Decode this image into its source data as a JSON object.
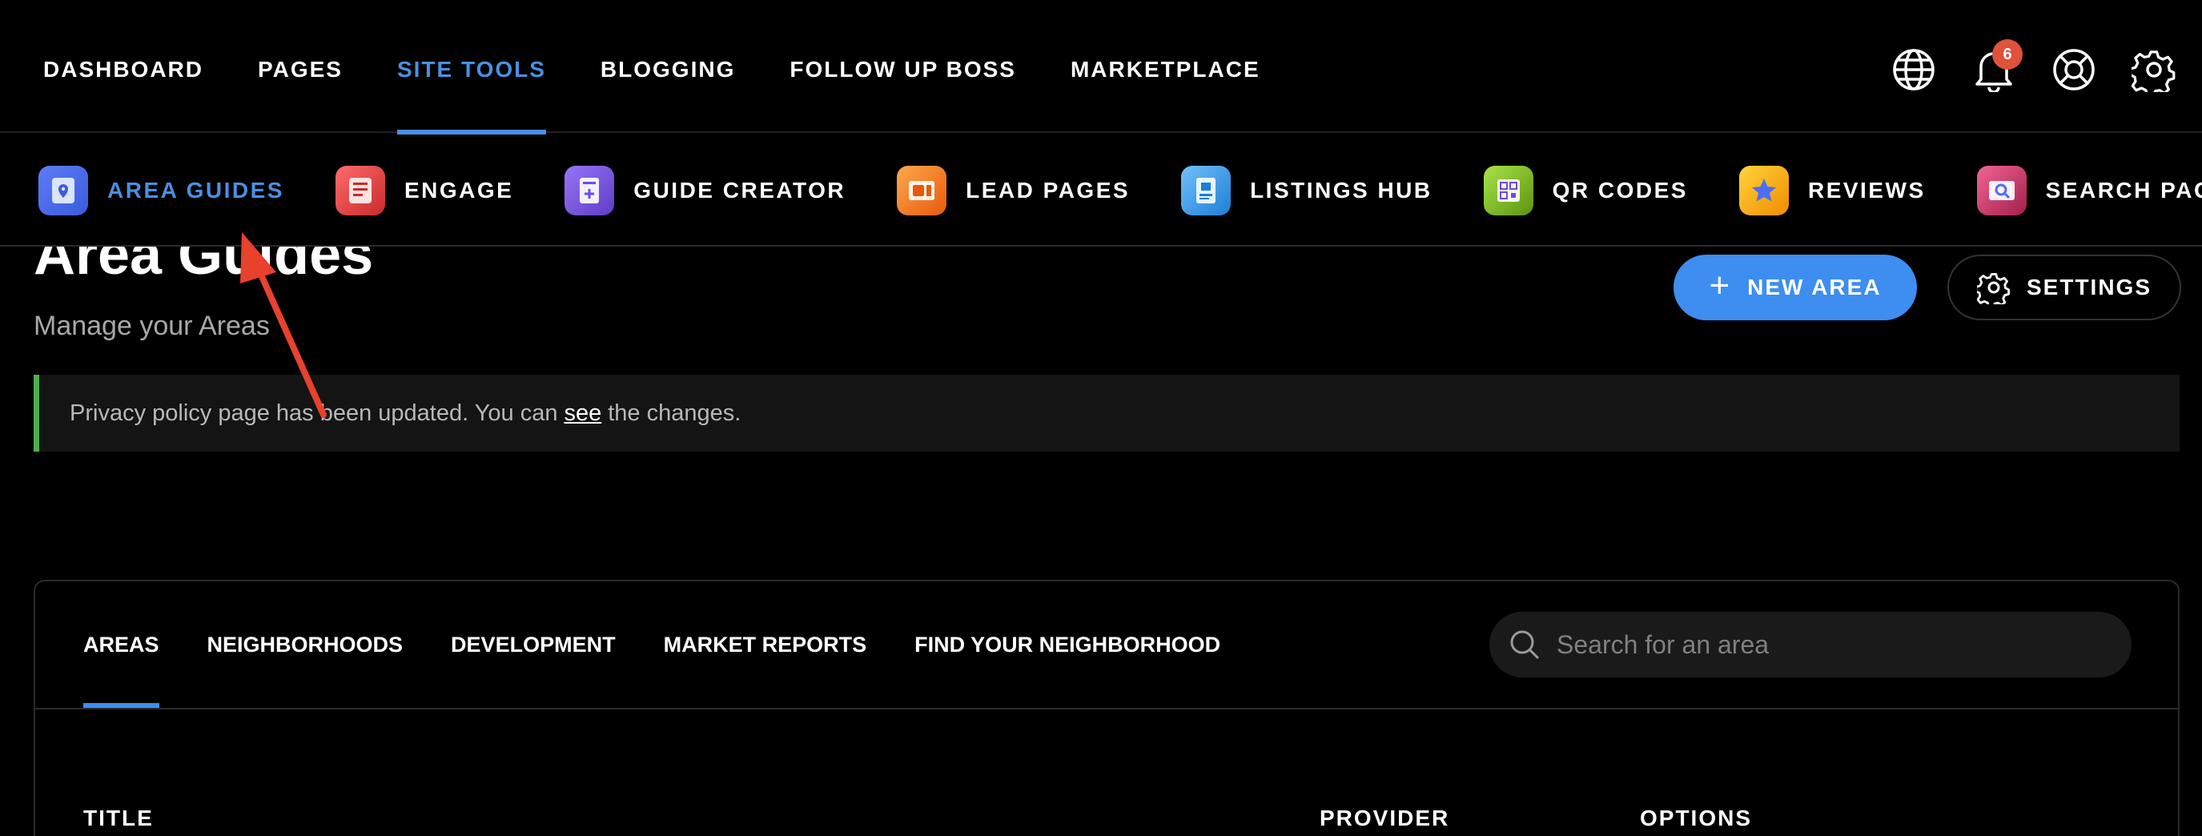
{
  "topnav": {
    "items": [
      {
        "label": "DASHBOARD"
      },
      {
        "label": "PAGES"
      },
      {
        "label": "SITE TOOLS"
      },
      {
        "label": "BLOGGING"
      },
      {
        "label": "FOLLOW UP BOSS"
      },
      {
        "label": "MARKETPLACE"
      }
    ],
    "active_index": 2,
    "notification_count": "6",
    "icons": [
      "globe-icon",
      "bell-icon",
      "help-lifebuoy-icon",
      "gear-icon"
    ]
  },
  "subnav": {
    "items": [
      {
        "label": "AREA GUIDES",
        "icon": "area-guides-icon",
        "color": "#3b5bdb"
      },
      {
        "label": "ENGAGE",
        "icon": "engage-icon",
        "color": "#d9383a"
      },
      {
        "label": "GUIDE CREATOR",
        "icon": "guide-creator-icon",
        "color": "#7048e8"
      },
      {
        "label": "LEAD PAGES",
        "icon": "lead-pages-icon",
        "color": "#f08c34"
      },
      {
        "label": "LISTINGS HUB",
        "icon": "listings-hub-icon",
        "color": "#4dabf7"
      },
      {
        "label": "QR CODES",
        "icon": "qr-codes-icon",
        "color": "#82c91e"
      },
      {
        "label": "REVIEWS",
        "icon": "reviews-icon",
        "color": "#f5b02e"
      },
      {
        "label": "SEARCH PAGES",
        "icon": "search-pages-icon",
        "color": "#c2255c"
      }
    ],
    "active_index": 0
  },
  "page": {
    "title": "Area Guides",
    "subtitle": "Manage your Areas",
    "new_button": "NEW AREA",
    "settings_button": "SETTINGS"
  },
  "notice": {
    "text_before": "Privacy policy page has been updated. You can",
    "link": "see",
    "text_after": "the changes.",
    "accent": "#4caf50"
  },
  "card": {
    "tabs": [
      {
        "label": "AREAS"
      },
      {
        "label": "NEIGHBORHOODS"
      },
      {
        "label": "DEVELOPMENT"
      },
      {
        "label": "MARKET REPORTS"
      },
      {
        "label": "FIND YOUR NEIGHBORHOOD"
      }
    ],
    "active_tab": 0,
    "search_placeholder": "Search for an area",
    "columns": [
      "TITLE",
      "PROVIDER",
      "OPTIONS"
    ]
  },
  "colors": {
    "accent": "#4a90e2",
    "primary_button": "#3d8ef0",
    "badge": "#e0523a",
    "annotation_arrow": "#e8412c"
  }
}
